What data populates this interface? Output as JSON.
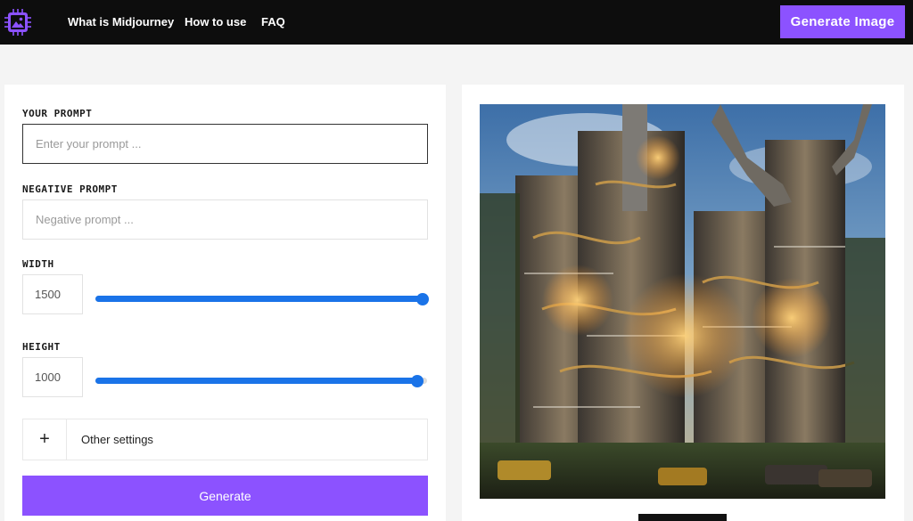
{
  "header": {
    "logo_icon": "image-chip-icon",
    "nav": [
      "What is Midjourney",
      "How to use",
      "FAQ"
    ],
    "cta_label": "Generate Image"
  },
  "form": {
    "prompt_label": "YOUR PROMPT",
    "prompt_placeholder": "Enter your prompt ...",
    "negative_label": "NEGATIVE PROMPT",
    "negative_placeholder": "Negative prompt ...",
    "width_label": "WIDTH",
    "width_value": "1500",
    "width_slider_fraction": 1.0,
    "height_label": "HEIGHT",
    "height_value": "1000",
    "height_slider_fraction": 0.97,
    "other_settings_icon": "plus-icon",
    "other_settings_label": "Other settings",
    "generate_label": "Generate"
  },
  "colors": {
    "accent": "#8c52ff",
    "slider": "#1a73e8",
    "header_bg": "#0d0d0d"
  }
}
